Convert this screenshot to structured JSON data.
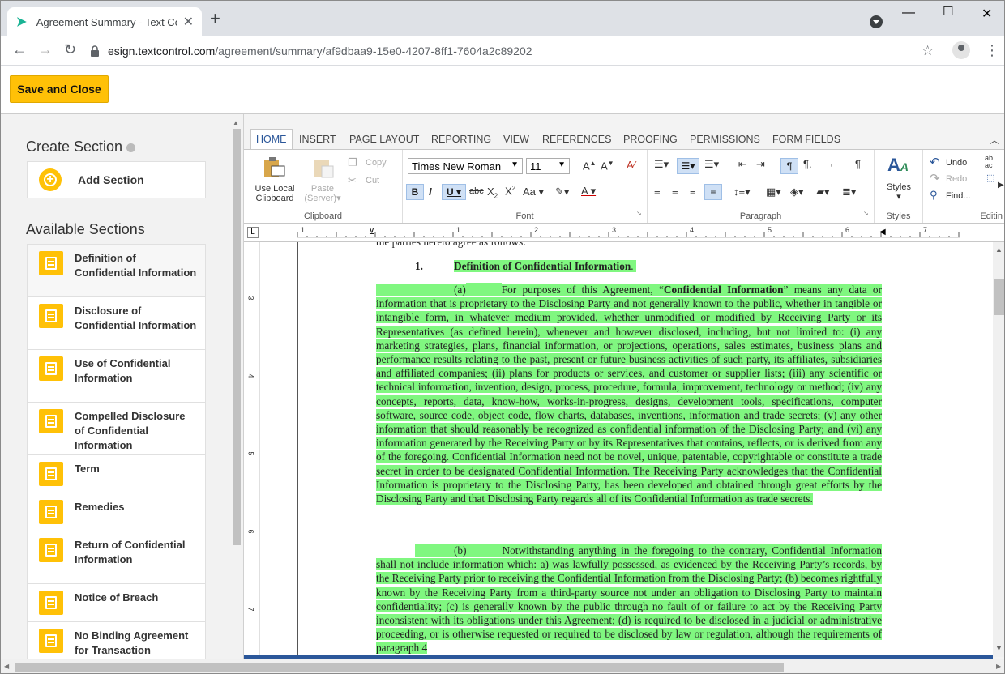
{
  "browser": {
    "tab_title": "Agreement Summary - Text Cont",
    "url_host": "esign.textcontrol.com",
    "url_path": "/agreement/summary/af9dbaa9-15e0-4207-8ff1-7604a2c89202"
  },
  "header": {
    "save_label": "Save and Close"
  },
  "sidebar": {
    "create_heading": "Create Section",
    "add_section_label": "Add Section",
    "available_heading": "Available Sections",
    "sections": [
      "Definition of Confidential Information",
      "Disclosure of Confidential Information",
      "Use of Confidential Information",
      "Compelled Disclosure of Confidential Information",
      "Term",
      "Remedies",
      "Return of Confidential Information",
      "Notice of Breach",
      "No Binding Agreement for Transaction"
    ]
  },
  "ribbon": {
    "tabs": [
      "HOME",
      "INSERT",
      "PAGE LAYOUT",
      "REPORTING",
      "VIEW",
      "REFERENCES",
      "PROOFING",
      "PERMISSIONS",
      "FORM FIELDS"
    ],
    "active_tab": "HOME",
    "groups": {
      "clipboard": "Clipboard",
      "font": "Font",
      "paragraph": "Paragraph",
      "styles": "Styles",
      "editing": "Editin"
    },
    "clipboard": {
      "use_local_1": "Use Local",
      "use_local_2": "Clipboard",
      "paste_1": "Paste",
      "paste_2": "(Server)",
      "copy": "Copy",
      "cut": "Cut"
    },
    "font": {
      "family": "Times New Roman",
      "size": "11"
    },
    "styles_label": "Styles",
    "editing": {
      "undo": "Undo",
      "redo": "Redo",
      "find": "Find..."
    }
  },
  "ruler": {
    "numbers": [
      "1",
      "1",
      "2",
      "3",
      "4",
      "5",
      "6",
      "7"
    ]
  },
  "vruler": {
    "numbers": [
      "3",
      "4",
      "5",
      "6",
      "7"
    ]
  },
  "document": {
    "top_fragment": "the parties hereto agree as follows:",
    "heading_number": "1.",
    "heading_text": "Definition of Confidential Information",
    "para_a_label": "(a)",
    "para_a_lead": "For purposes of this Agreement, “",
    "para_a_term": "Confidential Information",
    "para_a_body": "” means any data or information that is proprietary to the Disclosing Party and not generally known to the public, whether in tangible or intangible form, in whatever medium provided, whether unmodified or modified by Receiving Party or its Representatives (as defined herein), whenever and however disclosed, including, but not limited to: (i) any marketing strategies, plans, financial information, or projections, operations, sales estimates, business plans and performance results relating to the past, present or future business activities of such party, its affiliates, subsidiaries and affiliated companies; (ii) plans for products or services, and customer or supplier lists; (iii) any scientific or technical information, invention, design, process, procedure, formula, improvement, technology or method; (iv) any concepts, reports, data, know-how, works-in-progress, designs, development tools, specifications, computer software, source code, object code, flow charts, databases, inventions, information and trade secrets; (v) any other information that should reasonably be recognized as confidential information of the Disclosing Party; and (vi) any information generated by the Receiving Party or by its Representatives that contains, reflects, or is derived from any of the foregoing.  Confidential Information need not be novel, unique, patentable, copyrightable or constitute a trade secret in order to be designated Confidential Information.  The Receiving Party acknowledges that the Confidential Information is proprietary to the Disclosing Party, has been developed and obtained through great efforts by the Disclosing Party and that Disclosing Party regards all of its Confidential Information as trade secrets.",
    "para_b_label": "(b)",
    "para_b_body": "Notwithstanding anything in the foregoing to the contrary, Confidential Information shall not include information which: a) was lawfully possessed, as evidenced by the Receiving Party’s records, by the Receiving Party prior to receiving the Confidential Information from the Disclosing Party; (b) becomes rightfully known by the Receiving Party from a third-party source not under an obligation to Disclosing Party to maintain confidentiality; (c) is generally known by the public through no fault of or failure to act by the Receiving Party inconsistent with its obligations under this Agreement; (d) is required to be disclosed in a judicial or administrative proceeding, or is otherwise requested or required to be disclosed by law or regulation, although the requirements of paragraph 4"
  }
}
